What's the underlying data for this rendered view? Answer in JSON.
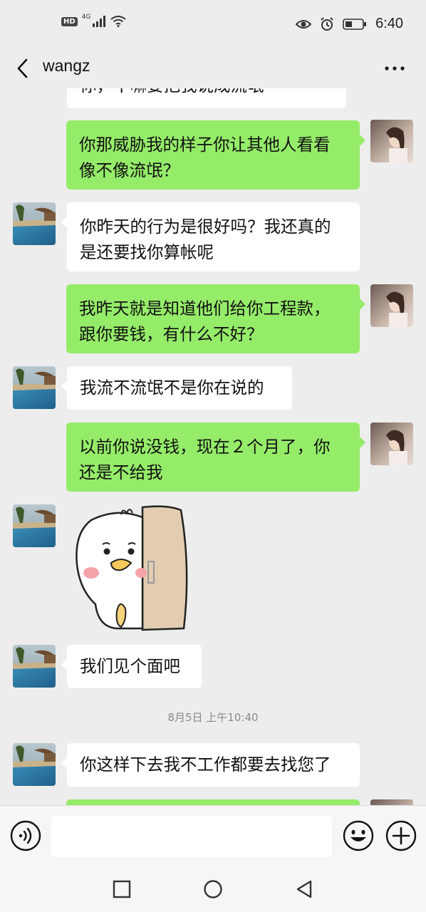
{
  "status_bar": {
    "hd": "HD",
    "network": "4G",
    "time": "6:40"
  },
  "header": {
    "title": "wangz",
    "back_icon": "chevron-left-icon",
    "more_icon": "more-horizontal-icon"
  },
  "messages": [
    {
      "id": "m0",
      "from": "them",
      "text": "你，干嘛要把我说成流氓"
    },
    {
      "id": "m1",
      "from": "me",
      "text": "你那威胁我的样子你让其他人看看\n像不像流氓？"
    },
    {
      "id": "m2",
      "from": "them",
      "text": "你昨天的行为是很好吗？我还真的\n是还要找你算帐呢"
    },
    {
      "id": "m3",
      "from": "me",
      "text": "我昨天就是知道他们给你工程款，\n跟你要钱，有什么不好？"
    },
    {
      "id": "m4",
      "from": "them",
      "text": "我流不流氓不是你在说的"
    },
    {
      "id": "m5",
      "from": "me",
      "text": "以前你说没钱，现在２个月了，你\n还是不给我"
    },
    {
      "id": "m6",
      "from": "them",
      "type": "sticker",
      "sticker": "duck-peeking-sticker"
    },
    {
      "id": "m7",
      "from": "them",
      "text": "我们见个面吧"
    },
    {
      "id": "m8",
      "from": "me",
      "text": ""
    }
  ],
  "timestamp": "8月5日 上午10:40",
  "last_message": {
    "from": "them",
    "text": "你这样下去我不工作都要去找您了"
  },
  "input_bar": {
    "voice_icon": "voice-icon",
    "emoji_icon": "emoji-icon",
    "plus_icon": "plus-icon"
  },
  "nav_bar": {
    "recent_icon": "square-icon",
    "home_icon": "circle-icon",
    "back_icon": "triangle-back-icon"
  },
  "colors": {
    "background": "#ededed",
    "incoming_bubble": "#ffffff",
    "outgoing_bubble": "#95ec69"
  }
}
